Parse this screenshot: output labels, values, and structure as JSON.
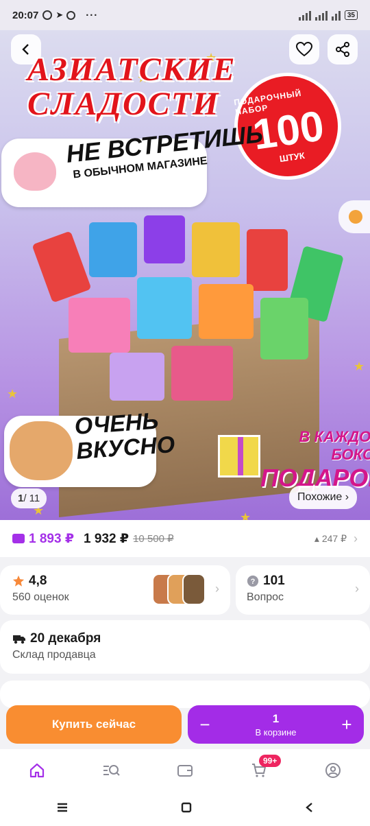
{
  "status_bar": {
    "time": "20:07",
    "battery": "35"
  },
  "hero": {
    "title_line1": "АЗИАТСКИЕ",
    "title_line2": "СЛАДОСТИ",
    "badge_top": "ПОДАРОЧНЫЙ НАБОР",
    "badge_number": "100",
    "badge_sub": "ШТУК",
    "sticker1_big": "НЕ ВСТРЕТИШЬ",
    "sticker1_small": "В ОБЫЧНОМ МАГАЗИНЕ",
    "sticker2_line1": "ОЧЕНЬ",
    "sticker2_line2": "ВКУСНО",
    "sticker3_small": "В КАЖДОМ БОКСЕ",
    "sticker3_big": "ПОДАРОК",
    "counter_current": "1",
    "counter_total": "/ 11",
    "similar_label": "Похожие ›"
  },
  "price": {
    "wallet_price": "1 893 ₽",
    "price": "1 932 ₽",
    "old_price": "10 500 ₽",
    "delta": "▴ 247 ₽"
  },
  "rating": {
    "value": "4,8",
    "count_label": "560 оценок"
  },
  "questions": {
    "count": "101",
    "label": "Вопрос"
  },
  "delivery": {
    "date": "20 декабря",
    "source": "Склад продавца"
  },
  "actions": {
    "buy_now": "Купить сейчас",
    "cart_qty": "1",
    "cart_label": "В корзине",
    "minus": "−",
    "plus": "+"
  },
  "nav": {
    "cart_badge": "99+"
  },
  "colors": {
    "accent": "#a430e8",
    "buy": "#f98d31",
    "badge": "#ee2560"
  }
}
